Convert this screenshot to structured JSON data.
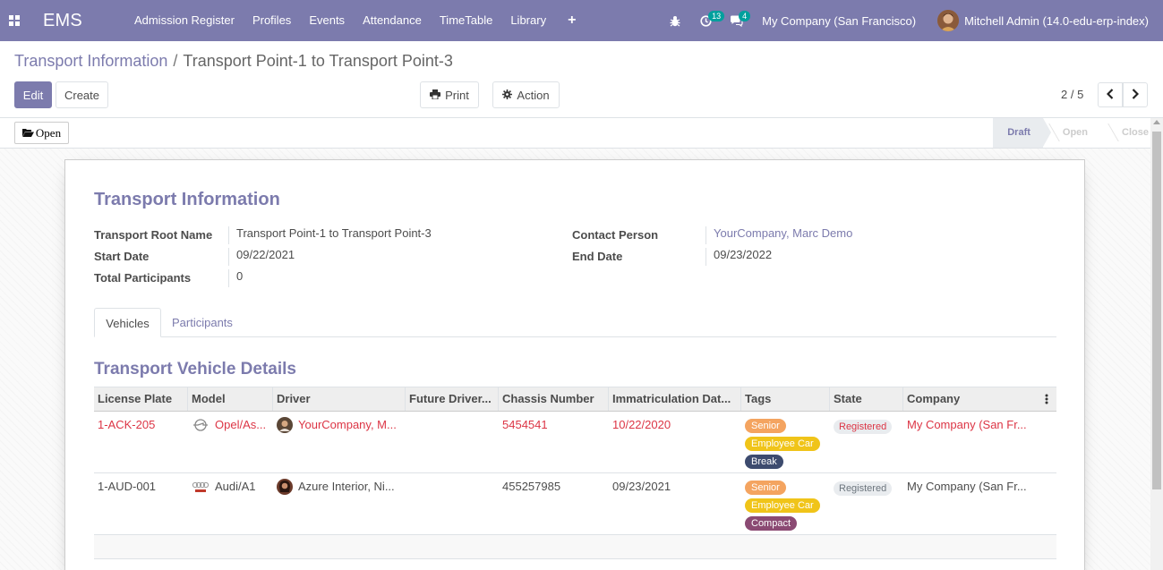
{
  "navbar": {
    "brand": "EMS",
    "menu": [
      "Admission Register",
      "Profiles",
      "Events",
      "Attendance",
      "TimeTable",
      "Library"
    ],
    "plus": "+",
    "activity_count": "13",
    "message_count": "4",
    "company": "My Company (San Francisco)",
    "user": "Mitchell Admin (14.0-edu-erp-index)"
  },
  "breadcrumb": {
    "parent": "Transport Information",
    "separator": "/",
    "current": "Transport Point-1 to Transport Point-3"
  },
  "buttons": {
    "edit": "Edit",
    "create": "Create",
    "print": "Print",
    "action": "Action",
    "open": "Open"
  },
  "pager": {
    "value": "2 / 5"
  },
  "stages": [
    "Draft",
    "Open",
    "Close"
  ],
  "active_stage": "Draft",
  "form": {
    "title": "Transport Information",
    "left_fields": [
      {
        "label": "Transport Root Name",
        "value": "Transport Point-1 to Transport Point-3"
      },
      {
        "label": "Start Date",
        "value": "09/22/2021"
      },
      {
        "label": "Total Participants",
        "value": "0"
      }
    ],
    "right_fields": [
      {
        "label": "Contact Person",
        "value": "YourCompany, Marc Demo"
      },
      {
        "label": "End Date",
        "value": "09/23/2022"
      }
    ],
    "tabs": [
      "Vehicles",
      "Participants"
    ],
    "section_title": "Transport Vehicle Details"
  },
  "table": {
    "columns": [
      "License Plate",
      "Model",
      "Driver",
      "Future Driver...",
      "Chassis Number",
      "Immatriculation Dat...",
      "Tags",
      "State",
      "Company"
    ],
    "rows": [
      {
        "license_plate": "1-ACK-205",
        "model": "Opel/As...",
        "driver": "YourCompany, M...",
        "future_driver": "",
        "chassis": "5454541",
        "date": "10/22/2020",
        "tags": [
          "Senior",
          "Employee Car",
          "Break"
        ],
        "state": "Registered",
        "company": "My Company (San Fr..."
      },
      {
        "license_plate": "1-AUD-001",
        "model": "Audi/A1",
        "driver": "Azure Interior, Ni...",
        "future_driver": "",
        "chassis": "455257985",
        "date": "09/23/2021",
        "tags": [
          "Senior",
          "Employee Car",
          "Compact"
        ],
        "state": "Registered",
        "company": "My Company (San Fr..."
      }
    ]
  },
  "colors": {
    "primary": "#7c7bad",
    "danger": "#dc3545",
    "tag_senior": "#f4a460",
    "tag_employee_car": "#f0c419",
    "tag_break": "#3d4b6e",
    "tag_compact": "#8b4a73"
  }
}
